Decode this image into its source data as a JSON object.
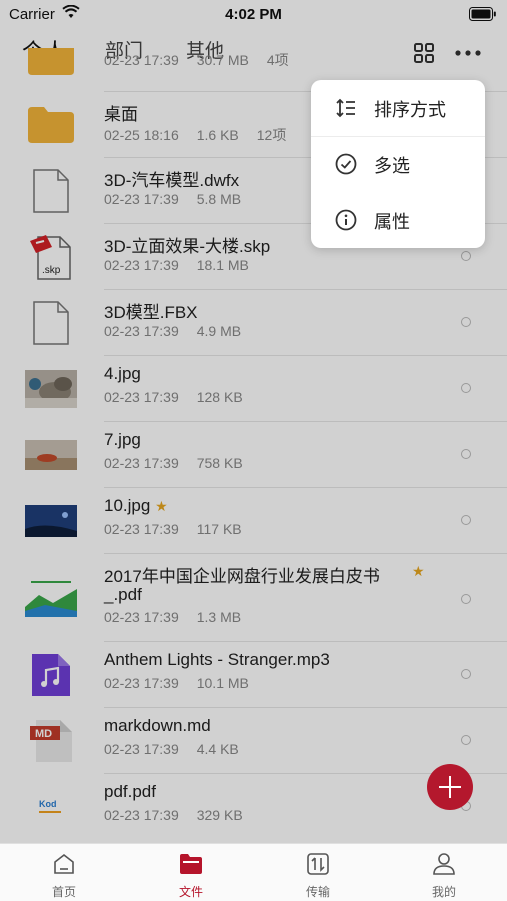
{
  "status": {
    "carrier": "Carrier",
    "time": "4:02 PM"
  },
  "tabs": [
    {
      "label": "个人"
    },
    {
      "label": "部门"
    },
    {
      "label": "其他"
    }
  ],
  "files": [
    {
      "name": "",
      "date": "02-23 17:39",
      "size": "30.7 MB",
      "count": "4项",
      "type": "folder"
    },
    {
      "name": "桌面",
      "date": "02-25 18:16",
      "size": "1.6 KB",
      "count": "12项",
      "type": "folder"
    },
    {
      "name": "3D-汽车模型.dwfx",
      "date": "02-23 17:39",
      "size": "5.8 MB",
      "type": "file"
    },
    {
      "name": "3D-立面效果-大楼.skp",
      "date": "02-23 17:39",
      "size": "18.1 MB",
      "type": "skp",
      "badge": ".skp"
    },
    {
      "name": "3D模型.FBX",
      "date": "02-23 17:39",
      "size": "4.9 MB",
      "type": "file"
    },
    {
      "name": "4.jpg",
      "date": "02-23 17:39",
      "size": "128 KB",
      "type": "image"
    },
    {
      "name": "7.jpg",
      "date": "02-23 17:39",
      "size": "758 KB",
      "type": "image"
    },
    {
      "name": "10.jpg",
      "date": "02-23 17:39",
      "size": "117 KB",
      "type": "image",
      "starred": true
    },
    {
      "name": "2017年中国企业网盘行业发展白皮书",
      "name2": "_.pdf",
      "date": "02-23 17:39",
      "size": "1.3 MB",
      "type": "pdf",
      "starred": true
    },
    {
      "name": "Anthem Lights - Stranger.mp3",
      "date": "02-23 17:39",
      "size": "10.1 MB",
      "type": "audio"
    },
    {
      "name": "markdown.md",
      "date": "02-23 17:39",
      "size": "4.4 KB",
      "type": "md",
      "badge": "MD"
    },
    {
      "name": "pdf.pdf",
      "date": "02-23 17:39",
      "size": "329 KB",
      "type": "pdf-thumb",
      "badge": "Kod"
    }
  ],
  "star_glyph": "★",
  "menu": {
    "sort": "排序方式",
    "multi_select": "多选",
    "properties": "属性"
  },
  "nav": [
    {
      "label": "首页"
    },
    {
      "label": "文件"
    },
    {
      "label": "传输"
    },
    {
      "label": "我的"
    }
  ],
  "colors": {
    "accent": "#b5142b",
    "folder": "#f2b43a"
  }
}
